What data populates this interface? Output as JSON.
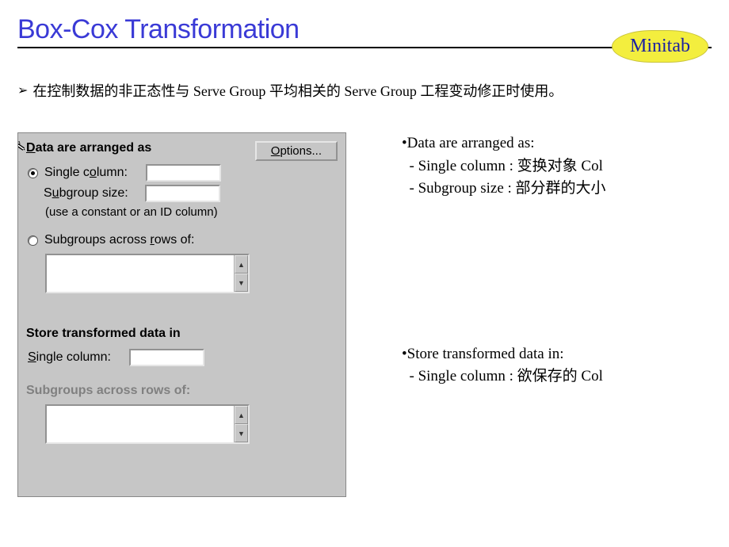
{
  "title": "Box-Cox Transformation",
  "badge": "Minitab",
  "intro_bullet": "➢",
  "intro_text": "在控制数据的非正态性与 Serve Group 平均相关的 Serve Group 工程变动修正时使用。",
  "dialog": {
    "group_label": "Data are arranged as",
    "options_button": "Options...",
    "radio1_label": "Single column:",
    "subgroup_label": "Subgroup size:",
    "subgroup_hint": "(use a constant or an ID column)",
    "radio2_label": "Subgroups across rows of:",
    "store_label": "Store transformed data in",
    "store_single_label": "Single column:",
    "store_rows_label": "Subgroups across rows of:",
    "single_column_value": "",
    "subgroup_size_value": "",
    "store_single_value": ""
  },
  "notes": {
    "n1_title": "•Data are arranged as:",
    "n1_a": "  - Single column : 变换对象 Col",
    "n1_b": "  - Subgroup size : 部分群的大小",
    "n2_title": "•Store transformed data in:",
    "n2_a": "  - Single column : 欲保存的 Col"
  }
}
